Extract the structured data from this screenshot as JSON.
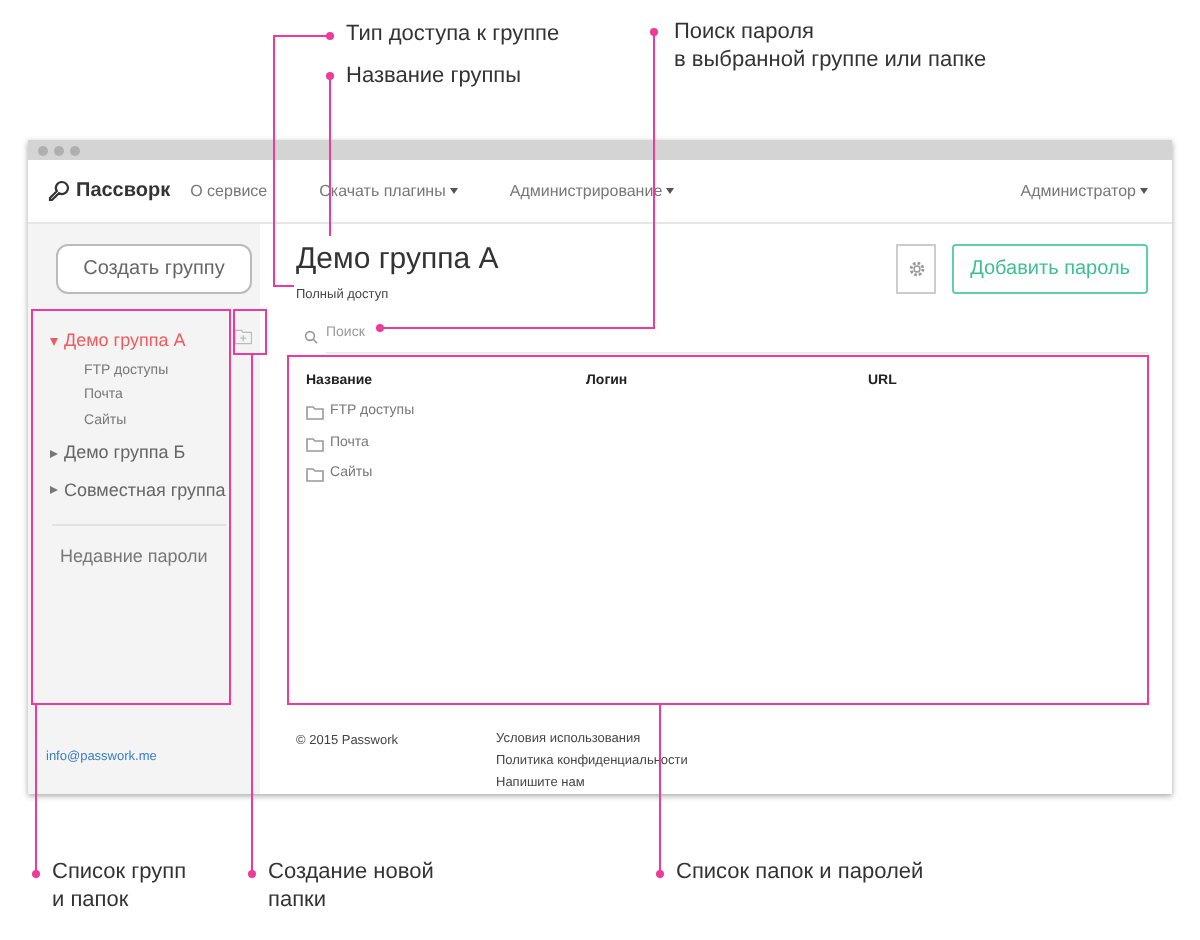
{
  "callouts": [
    {
      "text": "Тип доступа к группе"
    },
    {
      "text": "Название группы"
    },
    {
      "text": "Поиск пароля\nв выбранной группе или папке"
    },
    {
      "text": "Список групп\nи папок"
    },
    {
      "text": "Создание новой\nпапки"
    },
    {
      "text": "Список папок и паролей"
    }
  ],
  "navbar": {
    "logo": "Пассворк",
    "links": [
      {
        "label": "О сервисе",
        "dropdown": false
      },
      {
        "label": "Скачать плагины",
        "dropdown": true
      },
      {
        "label": "Администрирование",
        "dropdown": true
      }
    ],
    "user": {
      "label": "Администратор",
      "dropdown": true
    }
  },
  "sidebar": {
    "create_button": "Создать группу",
    "groups": [
      {
        "label": "Демо группа А",
        "selected": true,
        "expanded": true,
        "children": [
          {
            "label": "FTP доступы"
          },
          {
            "label": "Почта"
          },
          {
            "label": "Сайты"
          }
        ]
      },
      {
        "label": "Демо группа Б",
        "selected": false,
        "expanded": false
      },
      {
        "label": "Совместная группа",
        "selected": false,
        "expanded": false
      }
    ],
    "recent": "Недавние пароли",
    "email": "info@passwork.me"
  },
  "main": {
    "title": "Демо группа А",
    "access": "Полный доступ",
    "add_button": "Добавить пароль",
    "search": {
      "placeholder": "Поиск"
    },
    "table": {
      "columns": [
        "Название",
        "Логин",
        "URL"
      ],
      "rows": [
        {
          "name": "FTP доступы"
        },
        {
          "name": "Почта"
        },
        {
          "name": "Сайты"
        }
      ]
    }
  },
  "footer": {
    "copyright": "© 2015 Passwork",
    "links": [
      "Условия использования",
      "Политика конфиденциальности",
      "Напишите нам"
    ]
  }
}
